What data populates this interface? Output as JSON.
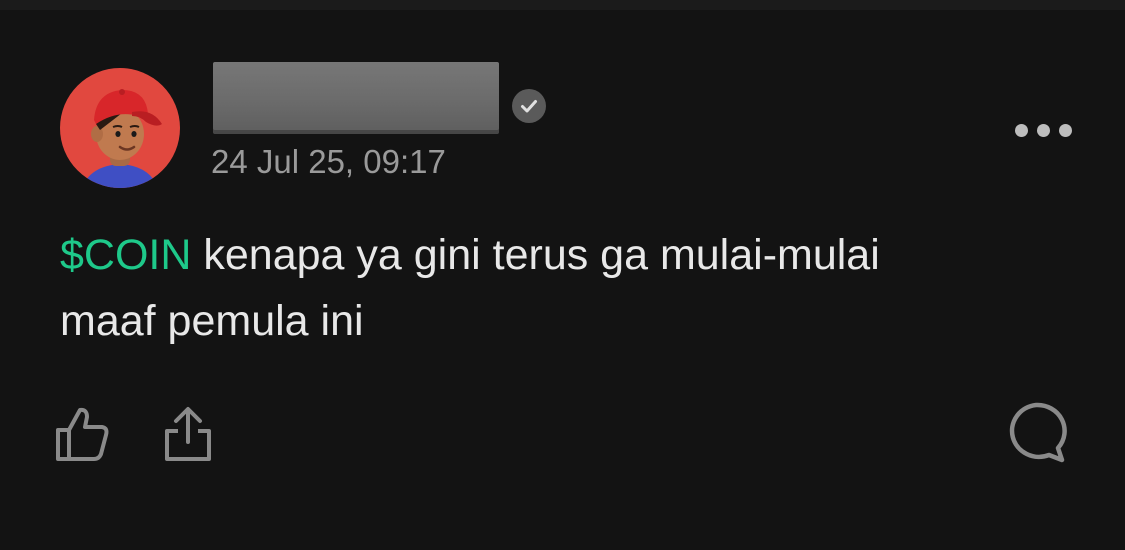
{
  "post": {
    "author": {
      "name": "",
      "verified": true
    },
    "timestamp": "24 Jul 25, 09:17",
    "ticker": "$COIN",
    "body_line1": " kenapa ya gini terus ga mulai-mulai",
    "body_line2": "maaf pemula ini"
  },
  "icons": {
    "avatar": "avatar-cartoon-boy-red-cap",
    "verified": "check-circle-icon",
    "more": "more-horizontal-icon",
    "like": "thumbs-up-icon",
    "share": "share-icon",
    "comment": "comment-bubble-icon"
  },
  "colors": {
    "background": "#131313",
    "text": "#e8e8e8",
    "muted": "#9a9a9a",
    "ticker": "#1ec98a",
    "avatar_bg": "#e1483f",
    "icon": "#8a8a8a"
  }
}
